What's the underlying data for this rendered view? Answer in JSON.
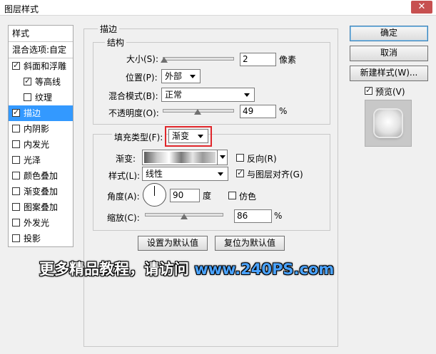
{
  "window": {
    "title": "图层样式",
    "close_symbol": "✕"
  },
  "left_panel": {
    "header": "样式",
    "blend_options": "混合选项:自定",
    "items": [
      {
        "label": "斜面和浮雕",
        "checked": true
      },
      {
        "label": "等高线",
        "checked": true
      },
      {
        "label": "纹理",
        "checked": false
      },
      {
        "label": "描边",
        "checked": true,
        "selected": true
      },
      {
        "label": "内阴影",
        "checked": false
      },
      {
        "label": "内发光",
        "checked": false
      },
      {
        "label": "光泽",
        "checked": false
      },
      {
        "label": "颜色叠加",
        "checked": false
      },
      {
        "label": "渐变叠加",
        "checked": false
      },
      {
        "label": "图案叠加",
        "checked": false
      },
      {
        "label": "外发光",
        "checked": false
      },
      {
        "label": "投影",
        "checked": false
      }
    ]
  },
  "stroke": {
    "section_title": "描边",
    "structure": {
      "title": "结构",
      "size_label": "大小(S):",
      "size_value": "2",
      "size_unit": "像素",
      "size_fraction": 0.02,
      "position_label": "位置(P):",
      "position_value": "外部",
      "blend_label": "混合模式(B):",
      "blend_value": "正常",
      "opacity_label": "不透明度(O):",
      "opacity_value": "49",
      "opacity_unit": "%",
      "opacity_fraction": 0.49
    },
    "fill": {
      "type_label": "填充类型(F):",
      "type_value": "渐变",
      "gradient_label": "渐变:",
      "reverse_label": "反向(R)",
      "reverse_checked": false,
      "style_label": "样式(L):",
      "style_value": "线性",
      "align_label": "与图层对齐(G)",
      "align_checked": true,
      "angle_label": "角度(A):",
      "angle_value": "90",
      "angle_unit": "度",
      "dither_label": "仿色",
      "dither_checked": false,
      "scale_label": "缩放(C):",
      "scale_value": "86",
      "scale_unit": "%",
      "scale_fraction": 0.5
    },
    "make_default": "设置为默认值",
    "reset_default": "复位为默认值"
  },
  "right": {
    "ok": "确定",
    "cancel": "取消",
    "new_style": "新建样式(W)...",
    "preview_label": "预览(V)",
    "preview_checked": true
  },
  "watermark": {
    "text": "更多精品教程，请访问",
    "url": "www.240PS.com"
  },
  "colors": {
    "selected": "#3399ff",
    "highlight_border": "#e0262b",
    "watermark_text": "#ffffff",
    "watermark_url": "#4aa3ff"
  }
}
